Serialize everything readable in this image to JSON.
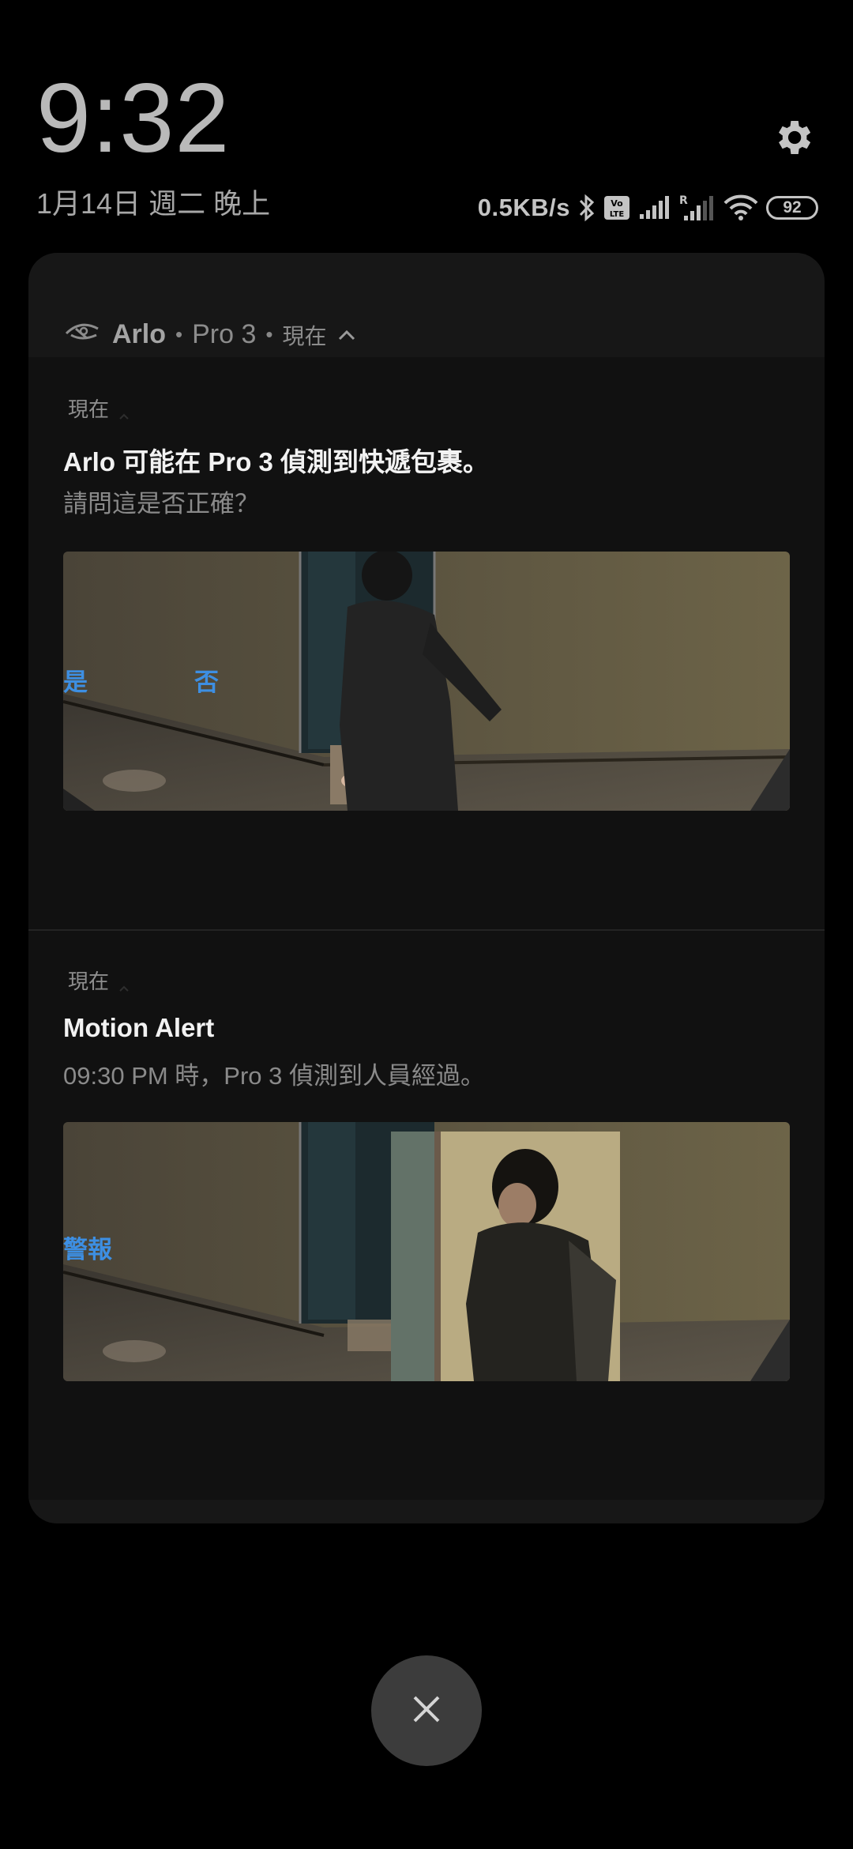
{
  "header": {
    "time": "9:32",
    "date": "1月14日 週二 晚上",
    "network_speed": "0.5KB/s",
    "battery": "92"
  },
  "icons": {
    "settings": "gear-icon",
    "bluetooth": "bluetooth-icon",
    "volte": "volte-icon",
    "signal1": "signal-icon",
    "signal2": "roaming-signal-icon",
    "wifi": "wifi-icon",
    "close": "close-icon",
    "app": "arlo-logo-icon"
  },
  "group": {
    "app_name": "Arlo",
    "device": "Pro 3",
    "time": "現在"
  },
  "notifications": [
    {
      "time": "現在",
      "title": "Arlo 可能在 Pro 3 偵測到快遞包裹。",
      "body": "請問這是否正確？",
      "actions": [
        "是",
        "否"
      ]
    },
    {
      "time": "現在",
      "title": "Motion Alert",
      "body": "09:30 PM 時，Pro 3 偵測到人員經過。",
      "actions": [
        "警報"
      ]
    }
  ],
  "colors": {
    "accent": "#3d8fe3",
    "card_bg": "#171717",
    "panel_bg": "#111111"
  }
}
